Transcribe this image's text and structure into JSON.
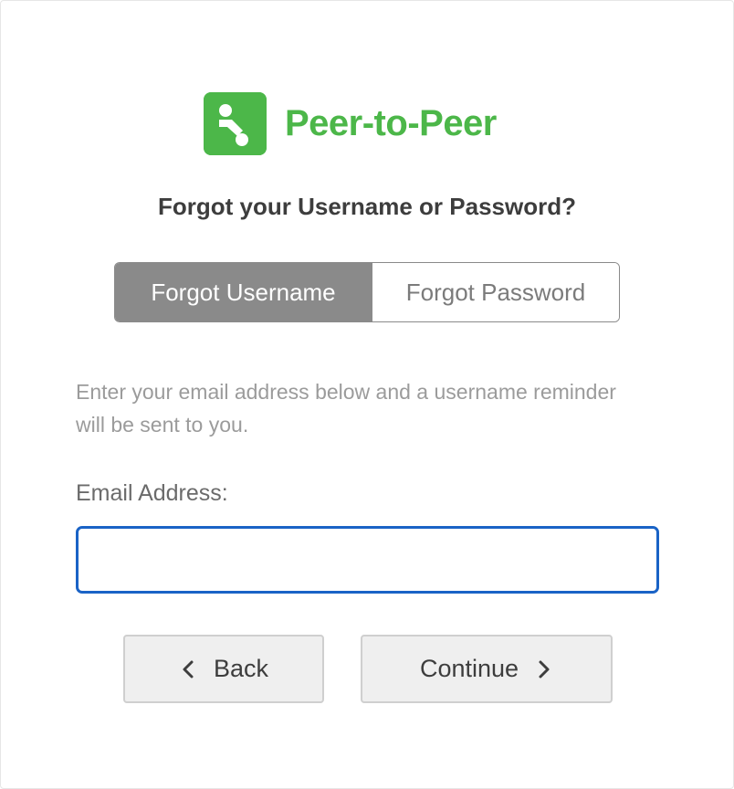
{
  "brand": {
    "name": "Peer-to-Peer",
    "logo_icon": "peer-to-peer-logo-icon",
    "color": "#4cb749"
  },
  "heading": "Forgot your Username or Password?",
  "tabs": [
    {
      "label": "Forgot Username",
      "active": true
    },
    {
      "label": "Forgot Password",
      "active": false
    }
  ],
  "instructions": "Enter your email address below and a username reminder will be sent to you.",
  "email": {
    "label": "Email Address:",
    "value": "",
    "placeholder": ""
  },
  "buttons": {
    "back_label": "Back",
    "back_icon": "chevron-left-icon",
    "continue_label": "Continue",
    "continue_icon": "chevron-right-icon"
  },
  "colors": {
    "accent_focus": "#1a63c6",
    "tab_active_bg": "#8a8a8a"
  }
}
